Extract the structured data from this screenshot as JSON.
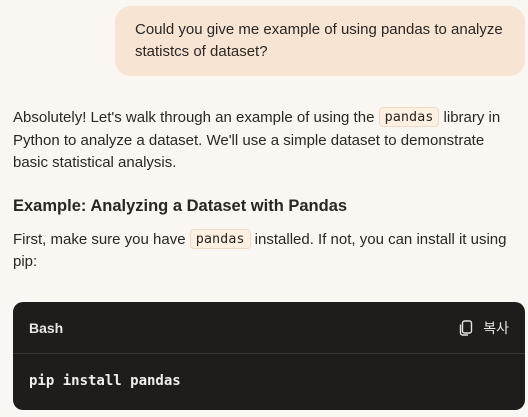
{
  "user_message": {
    "text": "Could you give me example of using pandas to analyze statistcs of dataset?"
  },
  "response": {
    "intro_before": "Absolutely! Let's walk through an example of using the ",
    "intro_code": "pandas",
    "intro_after": " library in Python to analyze a dataset. We'll use a simple dataset to demonstrate basic statistical analysis.",
    "heading": "Example: Analyzing a Dataset with Pandas",
    "install_before": "First, make sure you have ",
    "install_code": "pandas",
    "install_after": " installed. If not, you can install it using pip:"
  },
  "code_block": {
    "language": "Bash",
    "copy_label": "복사",
    "copy_icon": "copy-icon",
    "code": "pip install pandas"
  },
  "colors": {
    "background": "#faf6f2",
    "user_bubble": "#f7e4d3",
    "code_background": "#1f1d1b",
    "inline_code_background": "#fcf0e2"
  }
}
